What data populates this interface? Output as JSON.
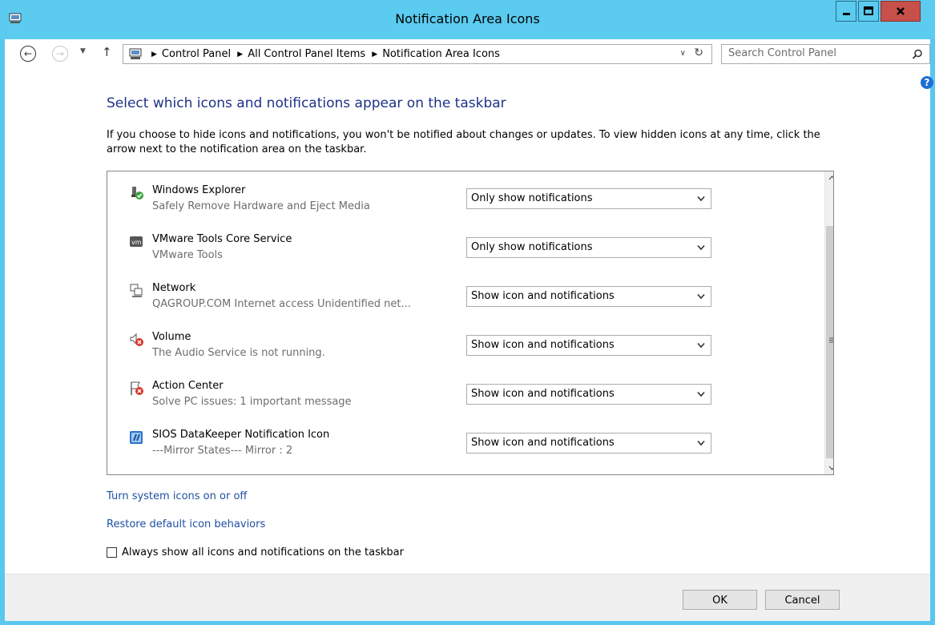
{
  "window": {
    "title": "Notification Area Icons",
    "app_icon": "control-panel-icon",
    "controls": {
      "minimize": "minimize-icon",
      "maximize": "maximize-icon",
      "close": "close-icon"
    },
    "accent_color": "#5bcbf0",
    "close_color": "#c7504a"
  },
  "address_bar": {
    "breadcrumbs": [
      "Control Panel",
      "All Control Panel Items",
      "Notification Area Icons"
    ],
    "search_placeholder": "Search Control Panel"
  },
  "main": {
    "heading": "Select which icons and notifications appear on the taskbar",
    "description": "If you choose to hide icons and notifications, you won't be notified about changes or updates. To view hidden icons at any time, click the arrow next to the notification area on the taskbar.",
    "items": [
      {
        "name": "Windows Explorer",
        "subtitle": "Safely Remove Hardware and Eject Media",
        "behavior": "Only show notifications",
        "icon": "usb-safe-remove-icon"
      },
      {
        "name": "VMware Tools Core Service",
        "subtitle": "VMware Tools",
        "behavior": "Only show notifications",
        "icon": "vmware-icon"
      },
      {
        "name": "Network",
        "subtitle": "QAGROUP.COM Internet access  Unidentified net...",
        "behavior": "Show icon and notifications",
        "icon": "network-icon"
      },
      {
        "name": "Volume",
        "subtitle": "The Audio Service is not running.",
        "behavior": "Show icon and notifications",
        "icon": "volume-error-icon"
      },
      {
        "name": "Action Center",
        "subtitle": "Solve PC issues: 1 important message",
        "behavior": "Show icon and notifications",
        "icon": "action-center-flag-icon"
      },
      {
        "name": "SIOS DataKeeper Notification Icon",
        "subtitle": "---Mirror States--- Mirror : 2",
        "behavior": "Show icon and notifications",
        "icon": "datakeeper-icon"
      }
    ],
    "links": {
      "system_icons": "Turn system icons on or off",
      "restore_defaults": "Restore default icon behaviors"
    },
    "always_show_label": "Always show all icons and notifications on the taskbar",
    "always_show_checked": false
  },
  "footer": {
    "ok_label": "OK",
    "cancel_label": "Cancel"
  }
}
